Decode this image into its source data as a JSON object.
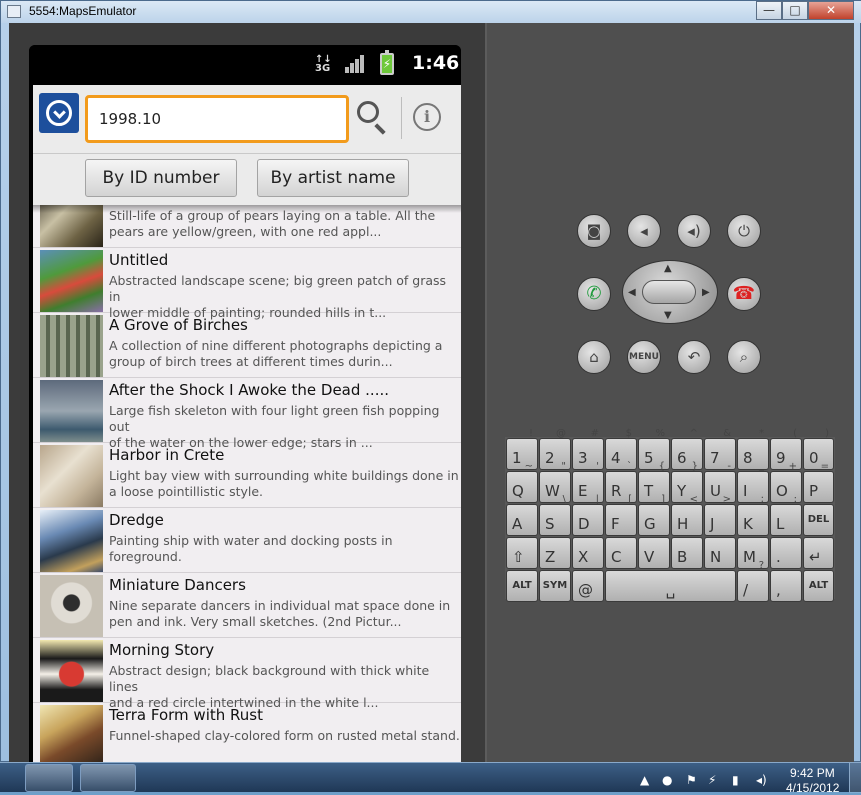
{
  "window": {
    "title": "5554:MapsEmulator",
    "minimize_label": "—",
    "maximize_label": "□",
    "close_label": "✕"
  },
  "statusbar": {
    "network": "3G",
    "clock": "1:46"
  },
  "header": {
    "search_value": "1998.10",
    "info_label": "i",
    "by_id_label": "By ID number",
    "by_artist_label": "By artist name"
  },
  "results": [
    {
      "title": "",
      "desc": "Still-life of a group of pears laying on a table.  All the\npears are yellow/green, with one red appl..."
    },
    {
      "title": "Untitled",
      "desc": "Abstracted landscape scene; big green patch of grass in\nlower middle of painting; rounded hills in t..."
    },
    {
      "title": "A Grove of Birches",
      "desc": "A collection of nine different photographs depicting a\ngroup of birch trees at different times durin..."
    },
    {
      "title": "After the Shock I Awoke the Dead .....",
      "desc": "Large fish skeleton with four light green fish popping out\nof the water on the lower edge; stars in ..."
    },
    {
      "title": "Harbor in Crete",
      "desc": "Light bay view with surrounding white buildings done in\na loose pointillistic style."
    },
    {
      "title": "Dredge",
      "desc": "Painting ship with water and docking posts in foreground."
    },
    {
      "title": "Miniature Dancers",
      "desc": "Nine separate dancers in individual mat space done in\npen and ink.  Very small sketches. (2nd Pictur..."
    },
    {
      "title": "Morning Story",
      "desc": "Abstract design; black background with thick white lines\nand a red circle intertwined in the white l..."
    },
    {
      "title": "Terra Form with Rust",
      "desc": "Funnel-shaped clay-colored form on rusted metal stand."
    }
  ],
  "controls": {
    "menu_label": "MENU"
  },
  "keyboard": {
    "row1": [
      [
        "1",
        "!"
      ],
      [
        "2",
        "@"
      ],
      [
        "3",
        "#"
      ],
      [
        "4",
        "$"
      ],
      [
        "5",
        "%"
      ],
      [
        "6",
        "^"
      ],
      [
        "7",
        "&"
      ],
      [
        "8",
        "*"
      ],
      [
        "9",
        "("
      ],
      [
        "0",
        ")"
      ]
    ],
    "row2": [
      [
        "Q",
        "~"
      ],
      [
        "W",
        "\""
      ],
      [
        "E",
        "'"
      ],
      [
        "R",
        "`"
      ],
      [
        "T",
        "{"
      ],
      [
        "Y",
        "}"
      ],
      [
        "U",
        "-"
      ],
      [
        "I",
        "_"
      ],
      [
        "O",
        "+"
      ],
      [
        "P",
        "="
      ]
    ],
    "row3": [
      [
        "A",
        ""
      ],
      [
        "S",
        "\\"
      ],
      [
        "D",
        "|"
      ],
      [
        "F",
        "["
      ],
      [
        "G",
        "]"
      ],
      [
        "H",
        "<"
      ],
      [
        "J",
        ">"
      ],
      [
        "K",
        ";"
      ],
      [
        "L",
        ":"
      ],
      [
        "DEL",
        ""
      ]
    ],
    "row4": [
      [
        "⇧",
        ""
      ],
      [
        "Z",
        ""
      ],
      [
        "X",
        ""
      ],
      [
        "C",
        ""
      ],
      [
        "V",
        ""
      ],
      [
        "B",
        ""
      ],
      [
        "N",
        ""
      ],
      [
        "M",
        ""
      ],
      [
        ".",
        ""
      ],
      [
        "↵",
        ""
      ]
    ],
    "row5": [
      [
        "ALT",
        ""
      ],
      [
        "SYM",
        ""
      ],
      [
        "@",
        ""
      ],
      [
        "␣",
        ""
      ],
      [
        "/",
        "?"
      ],
      [
        ",",
        ""
      ],
      [
        "ALT",
        ""
      ]
    ]
  },
  "taskbar": {
    "time": "9:42 PM",
    "date": "4/15/2012"
  }
}
